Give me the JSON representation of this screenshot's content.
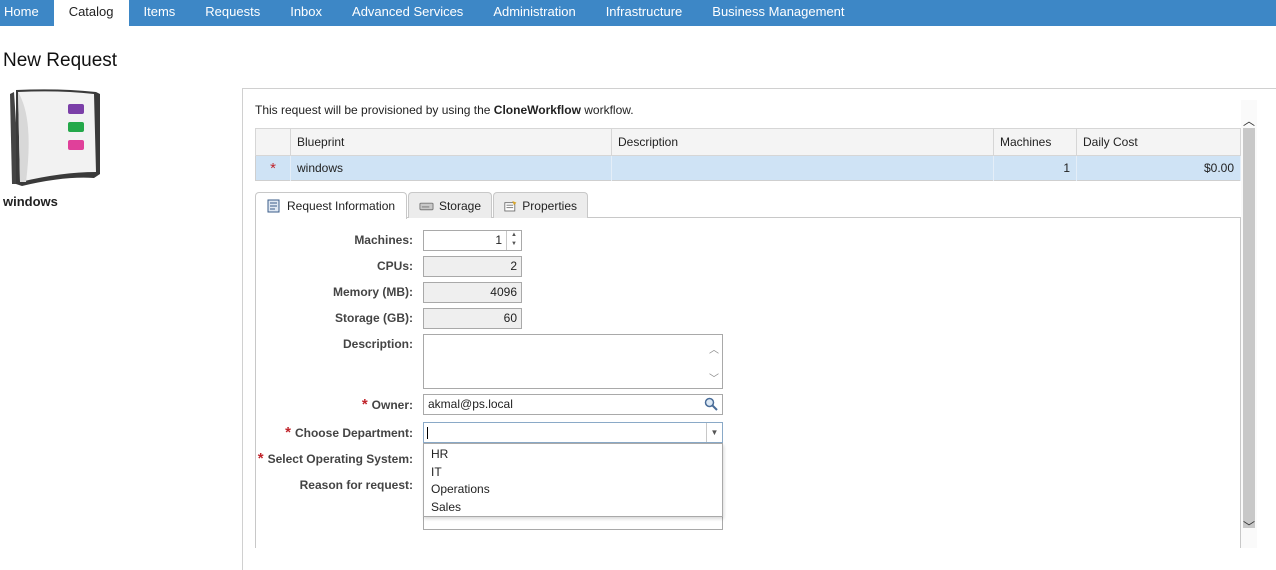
{
  "nav": {
    "tabs": [
      "Home",
      "Catalog",
      "Items",
      "Requests",
      "Inbox",
      "Advanced Services",
      "Administration",
      "Infrastructure",
      "Business Management"
    ],
    "active": "Catalog"
  },
  "page": {
    "title": "New Request",
    "catalog_item": "windows"
  },
  "workflow": {
    "prefix": "This request will be provisioned by using the ",
    "name": "CloneWorkflow",
    "suffix": " workflow."
  },
  "blueprint_table": {
    "headers": [
      "Blueprint",
      "Description",
      "Machines",
      "Daily Cost"
    ],
    "rows": [
      {
        "required": "*",
        "blueprint": "windows",
        "description": "",
        "machines": "1",
        "daily_cost": "$0.00"
      }
    ]
  },
  "tabs": [
    "Request Information",
    "Storage",
    "Properties"
  ],
  "form": {
    "machines_label": "Machines:",
    "machines_value": "1",
    "cpus_label": "CPUs:",
    "cpus_value": "2",
    "memory_label": "Memory (MB):",
    "memory_value": "4096",
    "storage_label": "Storage (GB):",
    "storage_value": "60",
    "description_label": "Description:",
    "owner_label": "Owner:",
    "owner_value": "akmal@ps.local",
    "department_label": "Choose Department:",
    "department_value": "",
    "department_options": [
      "HR",
      "IT",
      "Operations",
      "Sales"
    ],
    "os_label": "Select Operating System:",
    "reason_label": "Reason for request:",
    "required_mark": "*"
  },
  "colors": {
    "nav_bg": "#3d87c6",
    "selected_row": "#cfe3f5",
    "required": "#c0242b"
  }
}
